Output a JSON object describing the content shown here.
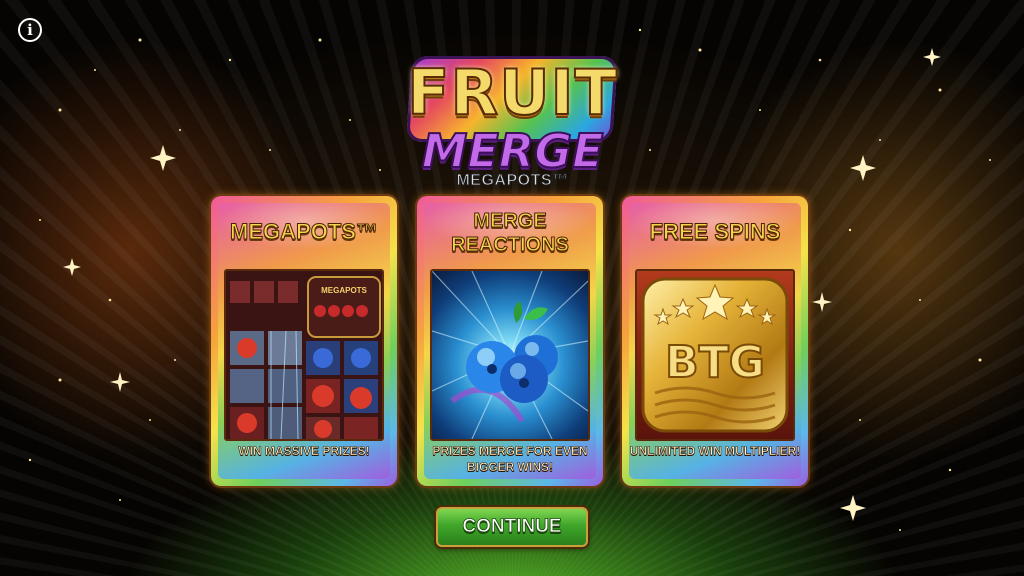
{
  "info_button": {
    "label": "i"
  },
  "logo": {
    "line1": "FRUIT",
    "line2": "MERGE",
    "line3": "MEGAPOTS™"
  },
  "cards": [
    {
      "title": "MEGAPOTS™",
      "description": "WIN MASSIVE PRIZES!",
      "image": "megapots-reels-preview",
      "reel_logo": "MEGAPOTS"
    },
    {
      "title": "MERGE REACTIONS",
      "description": "PRIZES MERGE FOR EVEN BIGGER WINS!",
      "image": "blueberry-burst-preview"
    },
    {
      "title": "FREE SPINS",
      "description": "UNLIMITED WIN MULTIPLIER!",
      "image": "btg-gold-badge",
      "badge_text": "BTG"
    }
  ],
  "continue_button": {
    "label": "CONTINUE"
  },
  "colors": {
    "button_green": "#3fa62a",
    "title_gold": "#f5d34e",
    "logo_purple": "#c36ae8"
  }
}
